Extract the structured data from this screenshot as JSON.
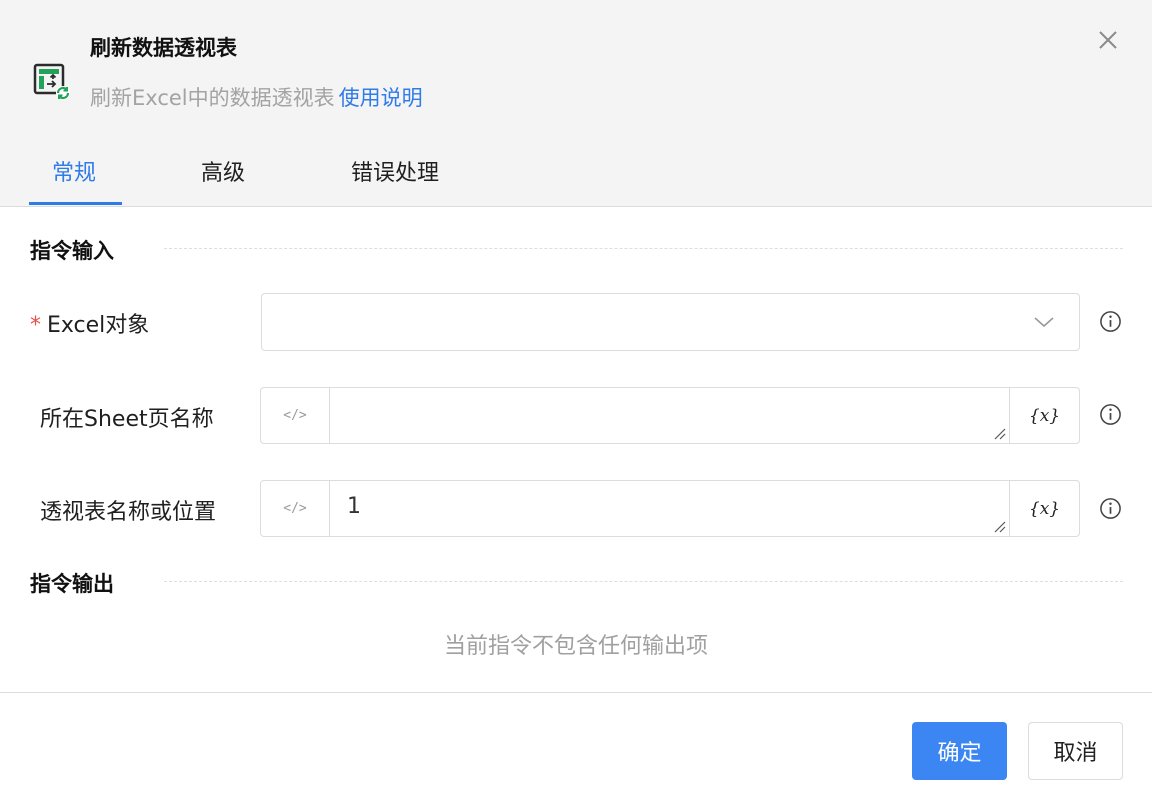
{
  "header": {
    "title": "刷新数据透视表",
    "subtitle": "刷新Excel中的数据透视表",
    "help_link": "使用说明"
  },
  "tabs": [
    {
      "label": "常规",
      "active": true
    },
    {
      "label": "高级",
      "active": false
    },
    {
      "label": "错误处理",
      "active": false
    }
  ],
  "input_section": {
    "title": "指令输入",
    "fields": [
      {
        "label": "Excel对象",
        "required": true,
        "type": "select",
        "value": ""
      },
      {
        "label": "所在Sheet页名称",
        "required": false,
        "type": "text",
        "value": "",
        "prefix_icon": "</>",
        "var_button": "{x}"
      },
      {
        "label": "透视表名称或位置",
        "required": false,
        "type": "text",
        "value": "1",
        "prefix_icon": "</>",
        "var_button": "{x}"
      }
    ]
  },
  "output_section": {
    "title": "指令输出",
    "empty_text": "当前指令不包含任何输出项"
  },
  "footer": {
    "confirm_label": "确定",
    "cancel_label": "取消"
  },
  "colors": {
    "accent": "#2f7be8",
    "primary_button": "#3b86f2",
    "required": "#e5534b",
    "header_bg": "#f4f4f4"
  },
  "icons": {
    "app": "excel-pivot-refresh-icon",
    "close": "close-icon",
    "dropdown": "chevron-down-icon",
    "info": "info-icon",
    "code": "code-icon",
    "variable": "variable-icon"
  }
}
